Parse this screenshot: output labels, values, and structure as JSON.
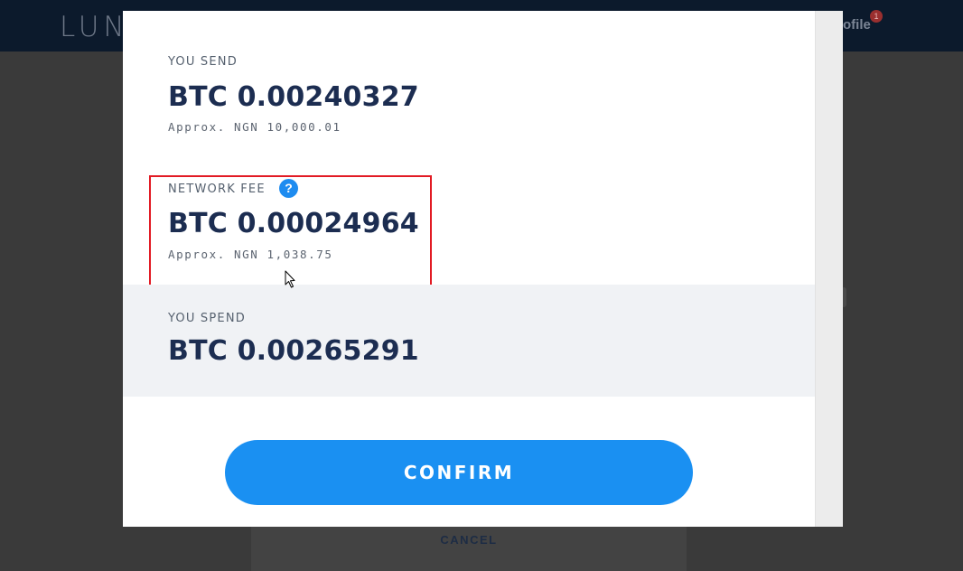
{
  "app": {
    "logo_text": "LUN",
    "profile_label": "ofile",
    "notification_count": "1",
    "cancel_label": "CANCEL"
  },
  "modal": {
    "you_send": {
      "label": "YOU SEND",
      "amount": "BTC 0.00240327",
      "approx": "Approx. NGN 10,000.01"
    },
    "network_fee": {
      "label": "NETWORK FEE",
      "help_icon": "?",
      "amount": "BTC 0.00024964",
      "approx": "Approx. NGN 1,038.75"
    },
    "you_spend": {
      "label": "YOU SPEND",
      "amount": "BTC 0.00265291"
    },
    "confirm_label": "CONFIRM"
  },
  "icons": {
    "help": "question-circle-icon",
    "cursor": "mouse-pointer-icon"
  },
  "colors": {
    "accent": "#1a90f2",
    "amount_text": "#1c2d51",
    "highlight": "#e21b24",
    "header_bg": "#0c1a2c"
  }
}
